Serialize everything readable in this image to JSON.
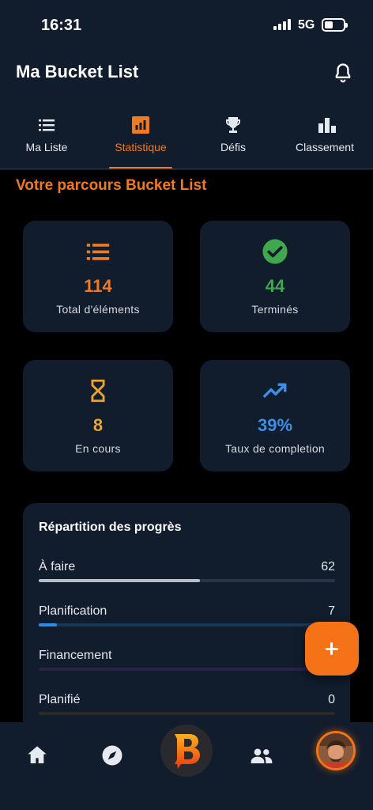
{
  "status_bar": {
    "time": "16:31",
    "network": "5G"
  },
  "header": {
    "title": "Ma Bucket List"
  },
  "tabs": [
    {
      "label": "Ma Liste",
      "icon": "list-icon",
      "active": false
    },
    {
      "label": "Statistique",
      "icon": "bar-chart-icon",
      "active": true
    },
    {
      "label": "Défis",
      "icon": "trophy-icon",
      "active": false
    },
    {
      "label": "Classement",
      "icon": "leaderboard-icon",
      "active": false
    }
  ],
  "section_title": "Votre parcours Bucket List",
  "stats": [
    {
      "value": "114",
      "label": "Total d'éléments",
      "icon": "list-icon",
      "color": "#f07a22"
    },
    {
      "value": "44",
      "label": "Terminés",
      "icon": "check-circle-icon",
      "color": "#3fa84f"
    },
    {
      "value": "8",
      "label": "En cours",
      "icon": "hourglass-icon",
      "color": "#f0a32c"
    },
    {
      "value": "39%",
      "label": "Taux de completion",
      "icon": "trending-up-icon",
      "color": "#3b8fe8"
    }
  ],
  "progress": {
    "title": "Répartition des progrès",
    "rows": [
      {
        "label": "À faire",
        "value": "62",
        "fraction": 0.544,
        "fill": "#b8bcc4",
        "track": "#2a3446"
      },
      {
        "label": "Planification",
        "value": "7",
        "fraction": 0.061,
        "fill": "#2f8de8",
        "track": "#17375a"
      },
      {
        "label": "Financement",
        "value": "",
        "fraction": 0,
        "fill": "#7a3fb8",
        "track": "#2b2346"
      },
      {
        "label": "Planifié",
        "value": "0",
        "fraction": 0,
        "fill": "#8a6a2a",
        "track": "#2c2a22"
      }
    ]
  },
  "colors": {
    "accent": "#f07a22",
    "surface": "#111c2c",
    "background": "#000000"
  },
  "bottom_nav": {
    "items": [
      "home-icon",
      "compass-icon",
      "app-logo",
      "group-icon",
      "avatar"
    ]
  }
}
